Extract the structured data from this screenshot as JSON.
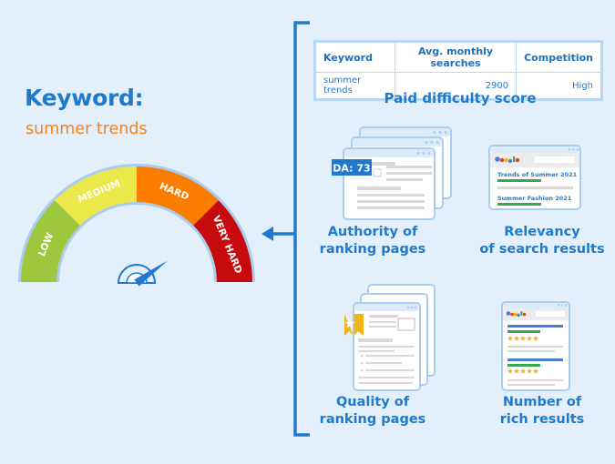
{
  "keyword_panel": {
    "title": "Keyword:",
    "value": "summer trends"
  },
  "gauge": {
    "segments": [
      {
        "label": "LOW",
        "color": "#9dc83e"
      },
      {
        "label": "MEDIUM",
        "color": "#ede84a"
      },
      {
        "label": "HARD",
        "color": "#fb7d00"
      },
      {
        "label": "VERY HARD",
        "color": "#c70a0d"
      }
    ],
    "needle_level": 0.8,
    "border_color": "#a9cdef",
    "needle_color": "#2178cc"
  },
  "table": {
    "headers": [
      "Keyword",
      "Avg. monthly searches",
      "Competition"
    ],
    "rows": [
      [
        "summer trends",
        "2900",
        "High"
      ]
    ]
  },
  "paid_difficulty_label": "Paid difficulty score",
  "factors": [
    {
      "label_line1": "Authority of",
      "label_line2": "ranking pages",
      "badge": "DA: 73",
      "icon": "stacked-pages-icon"
    },
    {
      "label_line1": "Relevancy",
      "label_line2": "of search results",
      "icon": "search-results-icon",
      "results": [
        "Trends of Summer 2021",
        "Summer Fashion 2021"
      ]
    },
    {
      "label_line1": "Quality of",
      "label_line2": "ranking pages",
      "icon": "bookmarked-pages-icon"
    },
    {
      "label_line1": "Number of",
      "label_line2": "rich results",
      "icon": "rich-results-icon",
      "rating_stars": 5
    }
  ],
  "colors": {
    "background": "#e3f0fc",
    "primary_blue": "#1f7acd",
    "accent_orange": "#f5821f",
    "light_border": "#a9cdef"
  }
}
